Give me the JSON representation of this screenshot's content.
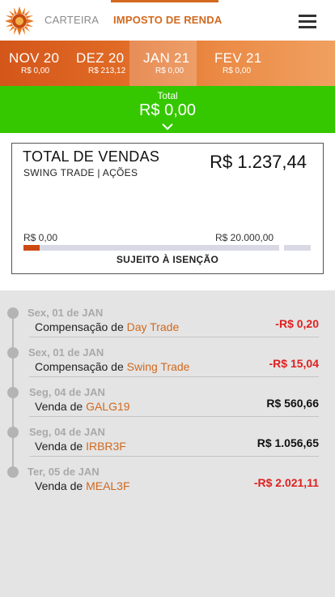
{
  "nav": {
    "tabs": [
      {
        "label": "CARTEIRA"
      },
      {
        "label": "IMPOSTO DE RENDA"
      }
    ],
    "menu_icon": "hamburger-icon",
    "logo_icon": "sun-logo-icon"
  },
  "months": [
    {
      "label": "NOV 20",
      "value": "R$ 0,00",
      "dot_color": "#3ecb1c"
    },
    {
      "label": "DEZ 20",
      "value": "R$ 213,12",
      "dot_color": "#f5a623"
    },
    {
      "label": "JAN 21",
      "value": "R$ 0,00",
      "dot_color": "#3ecb1c"
    },
    {
      "label": "FEV 21",
      "value": "R$ 0,00",
      "dot_color": "#3ecb1c"
    }
  ],
  "selected_month": "JAN 21",
  "total": {
    "label": "Total",
    "value": "R$ 0,00",
    "expand_icon": "chevron-down-icon"
  },
  "summary": {
    "title": "TOTAL DE VENDAS",
    "subtitle": "SWING TRADE | AÇÕES",
    "value": "R$ 1.237,44",
    "progress_min": "R$ 0,00",
    "progress_max": "R$ 20.000,00",
    "progress_fraction": 0.062,
    "progress_label": "SUJEITO À ISENÇÃO"
  },
  "transactions": [
    {
      "date": "Sex, 01 de JAN",
      "prefix": "Compensação de",
      "subject": "Day Trade",
      "amount": "-R$ 0,20",
      "negative": true
    },
    {
      "date": "Sex, 01 de JAN",
      "prefix": "Compensação de",
      "subject": "Swing Trade",
      "amount": "-R$ 15,04",
      "negative": true
    },
    {
      "date": "Seg, 04 de JAN",
      "prefix": "Venda de",
      "subject": "GALG19",
      "amount": "R$ 560,66",
      "negative": false
    },
    {
      "date": "Seg, 04 de JAN",
      "prefix": "Venda de",
      "subject": "IRBR3F",
      "amount": "R$ 1.056,65",
      "negative": false
    },
    {
      "date": "Ter, 05 de JAN",
      "prefix": "Venda de",
      "subject": "MEAL3F",
      "amount": "-R$ 2.021,11",
      "negative": true
    }
  ],
  "colors": {
    "accent": "#d2691e",
    "total_bar": "#35c800",
    "negative": "#e02020"
  }
}
